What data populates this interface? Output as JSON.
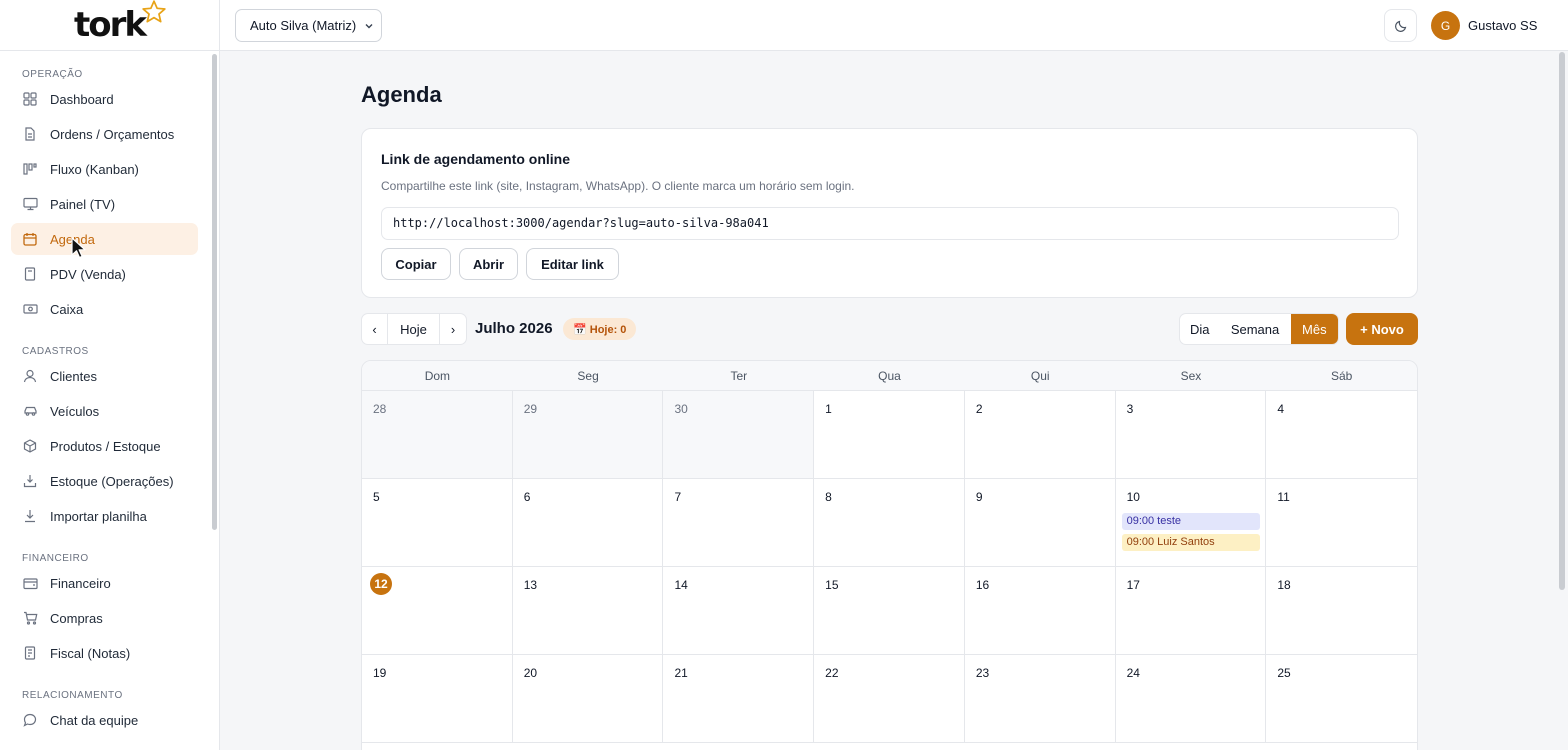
{
  "brand": {
    "logo_text": "tork",
    "accent": "#c7730f"
  },
  "topbar": {
    "company": "Auto Silva (Matriz)",
    "user_initial": "G",
    "user_name": "Gustavo SS"
  },
  "sidebar": {
    "sections": {
      "operacao": "OPERAÇÃO",
      "cadastros": "CADASTROS",
      "financeiro": "FINANCEIRO",
      "relacionamento": "RELACIONAMENTO"
    },
    "items": {
      "dashboard": "Dashboard",
      "ordens": "Ordens / Orçamentos",
      "fluxo": "Fluxo (Kanban)",
      "painel": "Painel (TV)",
      "agenda": "Agenda",
      "pdv": "PDV (Venda)",
      "caixa": "Caixa",
      "clientes": "Clientes",
      "veiculos": "Veículos",
      "produtos": "Produtos / Estoque",
      "estoque_op": "Estoque (Operações)",
      "importar": "Importar planilha",
      "financeiro": "Financeiro",
      "compras": "Compras",
      "fiscal": "Fiscal (Notas)",
      "chat": "Chat da equipe"
    }
  },
  "main": {
    "title": "Agenda",
    "link_card": {
      "title": "Link de agendamento online",
      "description": "Compartilhe este link (site, Instagram, WhatsApp). O cliente marca um horário sem login.",
      "url": "http://localhost:3000/agendar?slug=auto-silva-98a041",
      "copy_label": "Copiar",
      "open_label": "Abrir",
      "edit_label": "Editar link"
    },
    "calendar_toolbar": {
      "prev": "‹",
      "today": "Hoje",
      "next": "›",
      "month": "Julho 2026",
      "today_badge": "📅 Hoje: 0",
      "view_day": "Dia",
      "view_week": "Semana",
      "view_month": "Mês",
      "new_label": "+ Novo"
    },
    "calendar": {
      "weekdays": [
        "Dom",
        "Seg",
        "Ter",
        "Qua",
        "Qui",
        "Sex",
        "Sáb"
      ],
      "weeks": [
        [
          "28",
          "29",
          "30",
          "1",
          "2",
          "3",
          "4"
        ],
        [
          "5",
          "6",
          "7",
          "8",
          "9",
          "10",
          "11"
        ],
        [
          "12",
          "13",
          "14",
          "15",
          "16",
          "17",
          "18"
        ],
        [
          "19",
          "20",
          "21",
          "22",
          "23",
          "24",
          "25"
        ]
      ],
      "events": [
        {
          "label": "09:00 teste"
        },
        {
          "label": "09:00 Luiz Santos"
        }
      ]
    }
  }
}
